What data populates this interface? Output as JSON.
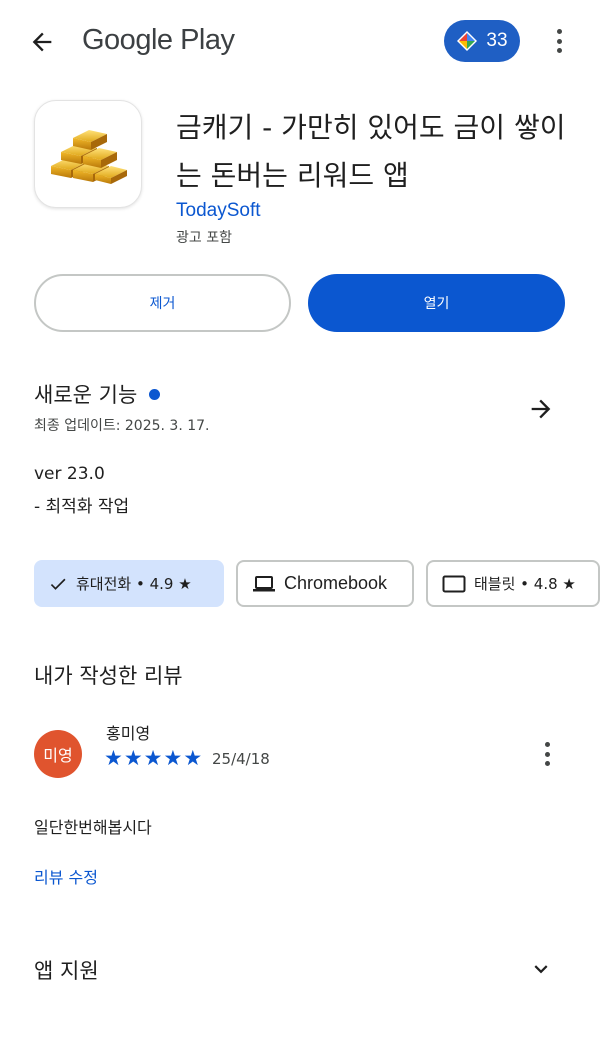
{
  "header": {
    "back_icon": "arrow-back-icon",
    "store_name": "Google Play",
    "points": "33",
    "points_icon": "play-points-diamond-icon",
    "more_icon": "more-vert-icon"
  },
  "app": {
    "icon": "gold-bars-icon",
    "title": "금캐기 - 가만히 있어도 금이 쌓이는 돈버는 리워드 앱",
    "developer": "TodaySoft",
    "ads_note": "광고 포함"
  },
  "actions": {
    "uninstall_label": "제거",
    "open_label": "열기"
  },
  "whats_new": {
    "title": "새로운 기능",
    "updated": "최종 업데이트: 2025. 3. 17.",
    "version": "ver 23.0",
    "notes": "- 최적화 작업",
    "arrow_icon": "arrow-forward-icon"
  },
  "device_chips": [
    {
      "label": "휴대전화 • 4.9 ★",
      "icon": "check-icon",
      "selected": true
    },
    {
      "label": "Chromebook",
      "icon": "laptop-icon",
      "selected": false
    },
    {
      "label": "태블릿 • 4.8 ★",
      "icon": "tablet-icon",
      "selected": false
    }
  ],
  "my_review": {
    "heading": "내가 작성한 리뷰",
    "avatar_initials": "미영",
    "reviewer": "홍미영",
    "rating": 5,
    "date": "25/4/18",
    "text": "일단한번해봅시다",
    "edit_label": "리뷰 수정"
  },
  "support": {
    "title": "앱 지원",
    "chevron_icon": "chevron-down-icon"
  },
  "colors": {
    "accent": "#0b57d0",
    "chip_selected_bg": "#d3e3fd",
    "avatar_bg": "#e0542e",
    "points_pill": "#1f5fc4"
  }
}
